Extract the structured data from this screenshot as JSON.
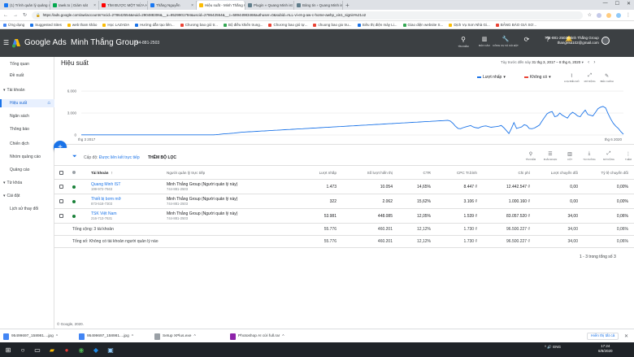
{
  "browser": {
    "tabs": [
      {
        "title": "(1) Trình quản lý quảng cáo - Qu...",
        "color": "#1877f2",
        "active": false
      },
      {
        "title": "tawk.to | Giám sát",
        "color": "#03a84e",
        "active": false
      },
      {
        "title": "TÌM ĐƯỢC MỘT NỬA HOA RẤ LI...",
        "color": "#ff0000",
        "active": false
      },
      {
        "title": "Thắng Nguyễn",
        "color": "#1877f2",
        "active": false
      },
      {
        "title": "Hiệu suất - Minh Thắng Group -",
        "color": "#fbbc04",
        "active": true
      },
      {
        "title": "Plugin « Quang Minh ist co.,ltd »...",
        "color": "#607d8b",
        "active": false
      },
      {
        "title": "Bảng tin ‹ Quang Minh ist co.,ltd...",
        "color": "#607d8b",
        "active": false
      }
    ],
    "new_tab": "+",
    "window_controls": {
      "minimize": "—",
      "maximize": "☐",
      "close": "✕"
    },
    "url": "https://ads.google.com/aw/accounts?ocid=278642554&euid=290488306&__u=8529901794&uscid=278642554&__c=58944983468authuser=0&subid=ALL-vi-et-g-aw-c-home-awhp_xin1_signin%21o2",
    "bookmarks": [
      {
        "label": "Ứng dụng",
        "color": "#4285f4"
      },
      {
        "label": "Suggested Sites",
        "color": "#1a73e8"
      },
      {
        "label": "web tham khảo",
        "color": "#fbbc04"
      },
      {
        "label": "Học LAZADA",
        "color": "#fbbc04"
      },
      {
        "label": "Hướng dẫn tạo liên...",
        "color": "#1a73e8"
      },
      {
        "label": "Chương bao gió tr...",
        "color": "#ea4335"
      },
      {
        "label": "Bộ điều khiển trung...",
        "color": "#34a853"
      },
      {
        "label": "Chương bao gió tự...",
        "color": "#ea4335"
      },
      {
        "label": "chuong bao gio tru...",
        "color": "#ea4335"
      },
      {
        "label": "Siêu thị điện máy Li...",
        "color": "#1a73e8"
      },
      {
        "label": "Giao diện website S...",
        "color": "#34a853"
      },
      {
        "label": "Dịch Vụ Sơn Nhà Gi...",
        "color": "#fbbc04"
      },
      {
        "label": "BẢNG BÁO GIÁ SƠ...",
        "color": "#ea4335"
      }
    ]
  },
  "ads_header": {
    "brand": "Google Ads",
    "account_name": "Minh Thắng Group",
    "account_id": "744-881-2503",
    "tools": [
      {
        "label": "TÌM KIẾM",
        "icon": "search-icon"
      },
      {
        "label": "BÁO CÁO",
        "icon": "report-icon"
      },
      {
        "label": "CÔNG CỤ VÀ CÀI ĐẶT",
        "icon": "wrench-icon"
      }
    ],
    "user_line1": "744-881-2503 Minh Thắng Group",
    "user_line2": "thangnsa102@gmail.com"
  },
  "sidebar": {
    "items": [
      {
        "label": "Tổng quan",
        "type": "child"
      },
      {
        "label": "Đề xuất",
        "type": "child"
      },
      {
        "label": "Tài khoản",
        "type": "parent"
      },
      {
        "label": "Hiệu suất",
        "type": "active"
      },
      {
        "label": "Ngân sách",
        "type": "child"
      },
      {
        "label": "Thông báo",
        "type": "child"
      },
      {
        "label": "Chiến dịch",
        "type": "child"
      },
      {
        "label": "Nhóm quảng cáo",
        "type": "child"
      },
      {
        "label": "Quảng cáo",
        "type": "child"
      },
      {
        "label": "Từ khóa",
        "type": "parent"
      },
      {
        "label": "Cài đặt",
        "type": "parent"
      },
      {
        "label": "Lịch sử thay đổi",
        "type": "child"
      }
    ]
  },
  "page": {
    "title": "Hiệu suất",
    "date_label": "Tùy trước đến này",
    "date_value": "31 thg 3, 2017 – 8 thg 6, 2020"
  },
  "chart": {
    "metric1": "Lượt nhấp",
    "metric1_color": "#1a73e8",
    "metric2": "Không có",
    "metric2_color": "#ea4335",
    "tools": [
      "LOẠI BIỂU ĐỒ",
      "MỞ RỘNG",
      "BIỂU CHÍNH"
    ]
  },
  "chart_data": {
    "type": "line",
    "series": [
      {
        "values": [
          20,
          20,
          20,
          20,
          20,
          20,
          20,
          20,
          20,
          20,
          20,
          20,
          20,
          20,
          20,
          20,
          20,
          20,
          20,
          20,
          20,
          20,
          20,
          20,
          20,
          20,
          20,
          20,
          20,
          20,
          20,
          20,
          20,
          20,
          20,
          20,
          20,
          20,
          20,
          20,
          20,
          20,
          20,
          20,
          20,
          20,
          20,
          20,
          20,
          20,
          20,
          20,
          20,
          40,
          80,
          120,
          160,
          180,
          200,
          230,
          260,
          300,
          340,
          380,
          400,
          420,
          440,
          460,
          480,
          500,
          520,
          540,
          560,
          580,
          600,
          620,
          640,
          660,
          680,
          700,
          720,
          740,
          760,
          780,
          800,
          820,
          840,
          860,
          880,
          900,
          920,
          940,
          960,
          980,
          1000,
          1020,
          1040,
          1060,
          1080,
          1100,
          1120,
          1140,
          1160,
          1180,
          1200,
          1220,
          1240,
          1260,
          1280,
          1300,
          1320,
          1340,
          1360,
          1380,
          1400,
          1420,
          1440,
          1460,
          1480,
          1500,
          1520,
          1540,
          1560,
          1580,
          1600,
          1620,
          1640,
          1660,
          1680,
          1700,
          1720,
          1740,
          1760,
          1780,
          1800,
          1820,
          1840,
          1860,
          1880,
          1900,
          1920,
          1940,
          1960,
          1980,
          2000,
          1900,
          1600,
          1200,
          900,
          850,
          1000,
          1100,
          1200,
          1300,
          1100,
          1000,
          950,
          1100,
          1200,
          1250,
          1150,
          1050,
          1100,
          1150,
          1200,
          1300,
          1000,
          600,
          200,
          900,
          1700,
          900,
          1000,
          1100,
          1400,
          1300,
          900,
          850,
          950,
          1150,
          1350,
          1900,
          2400,
          2900,
          3100,
          3200,
          2500,
          2600,
          3000,
          2700,
          2500,
          2300,
          2800,
          3100,
          2900,
          2600,
          2500,
          3000,
          3400,
          2800,
          2700,
          2600,
          3100,
          3600,
          3800,
          3900,
          3700,
          2900,
          2200,
          1600,
          1200,
          900,
          450,
          100
        ]
      }
    ],
    "y_ticks": [
      0,
      3000,
      6000
    ],
    "ylim": [
      0,
      6000
    ],
    "x_start_label": "thg 3 2017",
    "x_end_label": "thg 6 2020",
    "grid": true
  },
  "filter": {
    "label_prefix": "Cấp độ:",
    "label_value": "Được liên kết trực tiếp",
    "add_filter": "THÊM BỘ LỌC",
    "tools": [
      {
        "label": "TÌM KIẾM",
        "icon": "search-icon"
      },
      {
        "label": "PHÂN ĐOẠN",
        "icon": "segment-icon"
      },
      {
        "label": "CỘT",
        "icon": "columns-icon"
      },
      {
        "label": "TẢI XUỐNG",
        "icon": "download-icon"
      },
      {
        "label": "MỞ RỘNG",
        "icon": "expand-icon"
      },
      {
        "label": "THÊM",
        "icon": "more-icon"
      }
    ]
  },
  "table": {
    "columns": [
      "Tài khoản",
      "Người quản lý trực tiếp",
      "Lượt nhấp",
      "Số lượt hiển thị",
      "CTR",
      "CPC Tr.bình",
      "Chi phí",
      "Lượt chuyển đổi",
      "Tỷ lệ chuyển đổi"
    ],
    "sort_arrow": "↑",
    "rows": [
      {
        "name": "Quang Minh IST",
        "id": "199-972-7943",
        "manager": "Minh Thắng Group (Người quản lý này)",
        "manager_id": "744-881-2503",
        "clicks": "1.473",
        "impr": "10.054",
        "ctr": "14,65%",
        "cpc": "8.447 ₫",
        "cost": "12.442.547 ₫",
        "conv": "0,00",
        "conv_rate": "0,00%",
        "status_color": "#188038"
      },
      {
        "name": "Thiết bị bơm mỡ",
        "id": "873-518-7303",
        "manager": "Minh Thắng Group (Người quản lý này)",
        "manager_id": "744-881-2503",
        "clicks": "322",
        "impr": "2.062",
        "ctr": "15,62%",
        "cpc": "3.106 ₫",
        "cost": "1.000.160 ₫",
        "conv": "0,00",
        "conv_rate": "0,00%",
        "status_color": "#188038"
      },
      {
        "name": "TSK Việt Nam",
        "id": "216-713-7631",
        "manager": "Minh Thắng Group (Người quản lý này)",
        "manager_id": "744-881-2503",
        "clicks": "53.981",
        "impr": "448.085",
        "ctr": "12,05%",
        "cpc": "1.539 ₫",
        "cost": "83.057.520 ₫",
        "conv": "34,00",
        "conv_rate": "0,06%",
        "status_color": "#188038"
      }
    ],
    "totals": [
      {
        "label": "Tổng cộng: 3 tài khoản",
        "clicks": "55.776",
        "impr": "460.201",
        "ctr": "12,12%",
        "cpc": "1.730 ₫",
        "cost": "96.500.227 ₫",
        "conv": "34,00",
        "conv_rate": "0,06%"
      },
      {
        "label": "Tổng số: Không có tài khoản người quản lý nào",
        "clicks": "55.776",
        "impr": "460.201",
        "ctr": "12,12%",
        "cpc": "1.730 ₫",
        "cost": "96.500.227 ₫",
        "conv": "34,00",
        "conv_rate": "0,06%"
      }
    ],
    "pagination": "1 - 3 trong tổng số 3"
  },
  "footer": {
    "copyright": "© Google, 2020."
  },
  "downloads": {
    "items": [
      {
        "name": "95499697_158981....jpg",
        "color": "#4285f4"
      },
      {
        "name": "95499697_158981....jpg",
        "color": "#4285f4"
      },
      {
        "name": "Setup XPlus.exe",
        "color": "#9aa0a6"
      },
      {
        "name": "Photoshop AI cửi full.rar",
        "color": "#8e24aa"
      }
    ],
    "show_all": "Hiển thị tất cả",
    "close": "✕"
  },
  "taskbar": {
    "tray_text": "^  🔊  ENG",
    "time": "17:24",
    "date": "6/8/2020"
  }
}
